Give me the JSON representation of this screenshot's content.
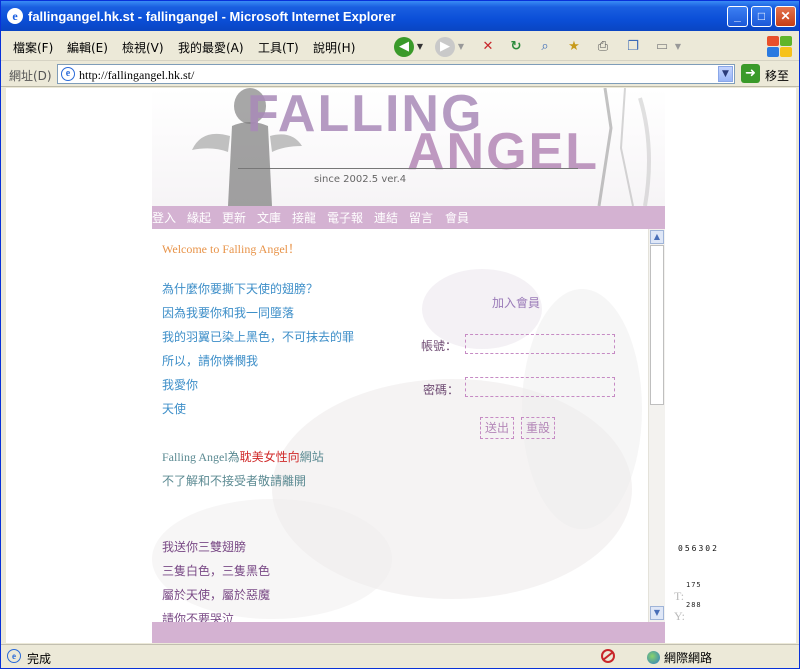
{
  "window": {
    "title": "fallingangel.hk.st - fallingangel - Microsoft Internet Explorer",
    "minimize": "_",
    "maximize": "□",
    "close": "✕"
  },
  "menu": [
    "檔案(F)",
    "編輯(E)",
    "檢視(V)",
    "我的最愛(A)",
    "工具(T)",
    "說明(H)"
  ],
  "address": {
    "label": "網址(D)",
    "url": "http://fallingangel.hk.st/",
    "go_label": "移至"
  },
  "site": {
    "logo_line1": "FALLING",
    "logo_line2": "ANGEL",
    "since": "since 2002.5  ver.4",
    "nav": [
      "登入",
      "緣起",
      "更新",
      "文庫",
      "接龍",
      "電子報",
      "連結",
      "留言",
      "會員"
    ],
    "welcome": "Welcome to Falling Angel！",
    "poem": [
      "為什麼你要撕下天使的翅膀？",
      "因為我要你和我一同墮落",
      "我的羽翼已染上黑色，不可抹去的罪",
      "所以，請你憐憫我",
      "我愛你",
      "天使"
    ],
    "notice_prefix": "Falling Angel為",
    "notice_highlight": "耽美女性向",
    "notice_suffix": "網站",
    "notice_line2": "不了解和不接受者敬請離開",
    "poem2": [
      "我送你三雙翅膀",
      "三隻白色，三隻黑色",
      "屬於天使，屬於惡魔",
      "請你不要哭泣"
    ],
    "join_label": "加入會員",
    "account_label": "帳號：",
    "password_label": "密碼：",
    "submit_label": "送出",
    "reset_label": "重設",
    "counter": "056302",
    "coord_t_label": "T:",
    "coord_t_value": "175",
    "coord_y_label": "Y:",
    "coord_y_value": "288"
  },
  "status": {
    "text": "完成",
    "zone": "網際網路"
  }
}
